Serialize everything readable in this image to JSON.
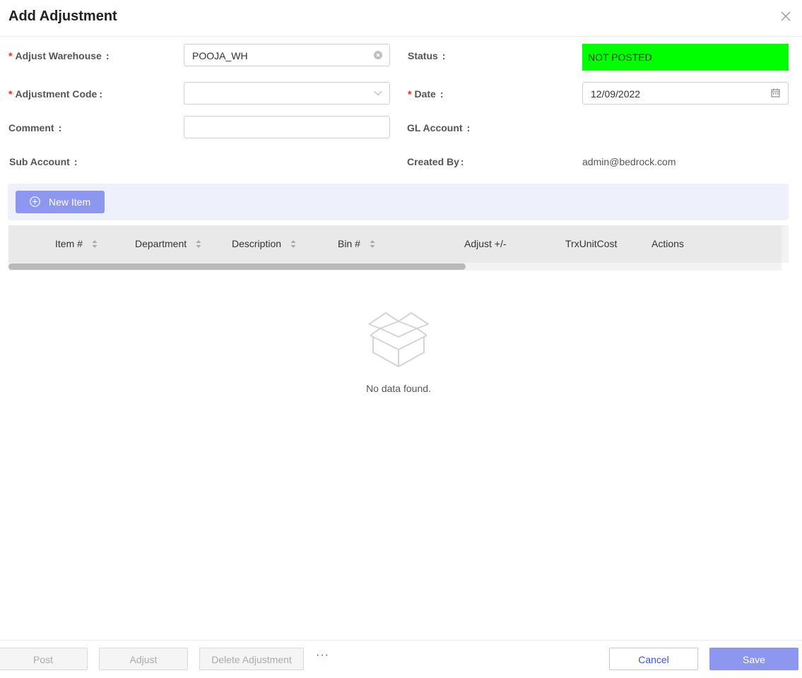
{
  "dialog": {
    "title": "Add Adjustment"
  },
  "form": {
    "adjust_warehouse": {
      "label": "Adjust Warehouse",
      "value": "POOJA_WH"
    },
    "adjustment_code": {
      "label": "Adjustment Code",
      "value": ""
    },
    "comment": {
      "label": "Comment",
      "value": ""
    },
    "sub_account": {
      "label": "Sub Account"
    },
    "status": {
      "label": "Status",
      "value": "NOT POSTED",
      "color": "#00ff00"
    },
    "date": {
      "label": "Date",
      "value": "12/09/2022"
    },
    "gl_account": {
      "label": "GL Account"
    },
    "created_by": {
      "label": "Created By",
      "value": "admin@bedrock.com"
    },
    "required_mark": "*",
    "colon": ":"
  },
  "toolbar": {
    "new_item_label": "New Item"
  },
  "table": {
    "columns": [
      "Item #",
      "Department",
      "Description",
      "Bin #",
      "Adjust +/-",
      "TrxUnitCost",
      "Actions"
    ],
    "empty_text": "No data found."
  },
  "footer": {
    "post_label": "Post",
    "adjust_label": "Adjust",
    "delete_label": "Delete Adjustment",
    "more_label": "···",
    "cancel_label": "Cancel",
    "save_label": "Save"
  },
  "colors": {
    "accent": "#8d97ef",
    "link": "#3b54d9",
    "required": "#e0301e"
  }
}
